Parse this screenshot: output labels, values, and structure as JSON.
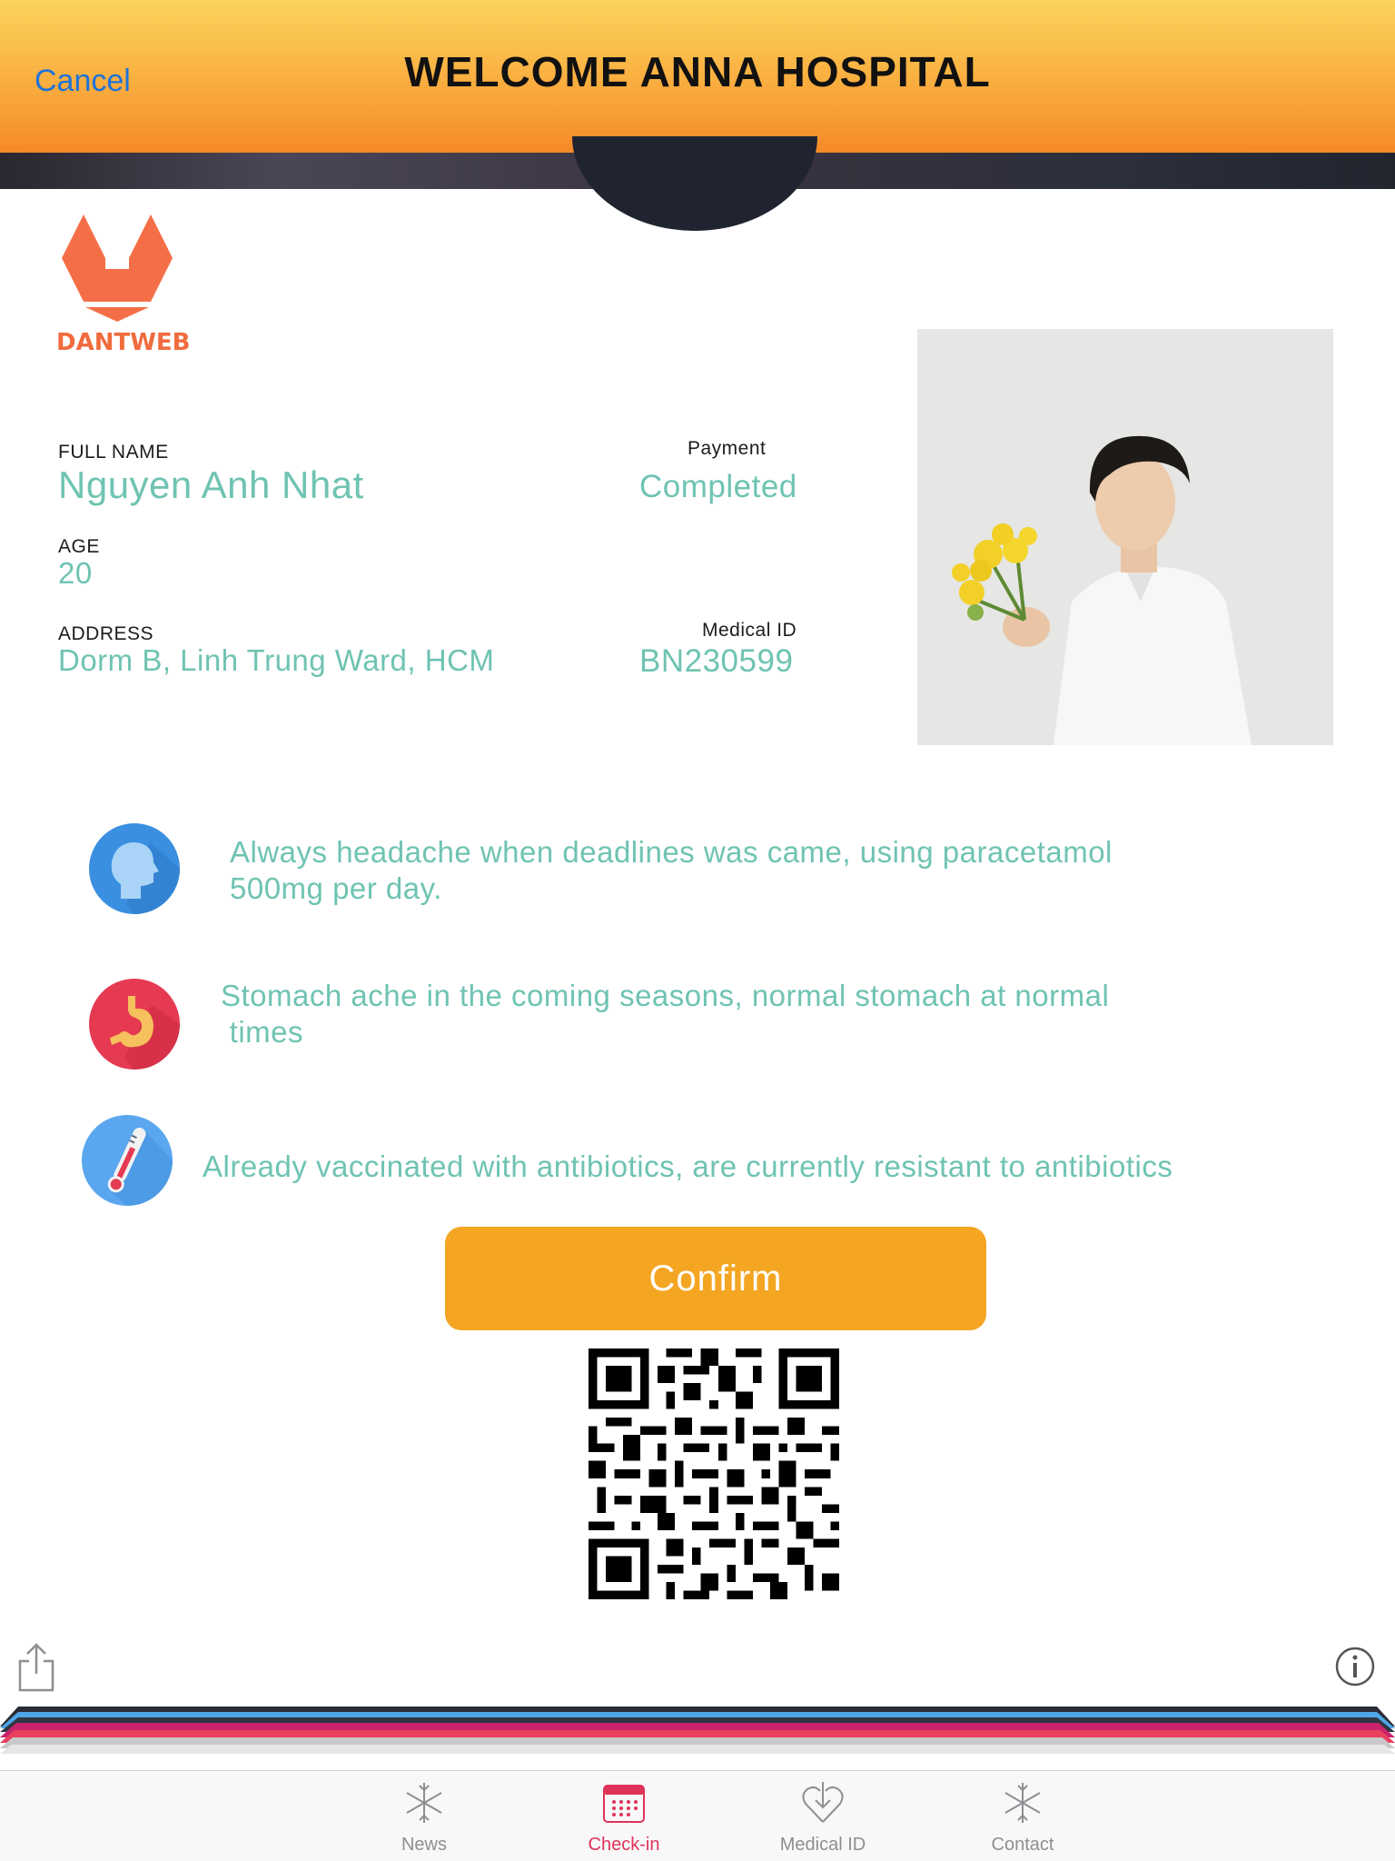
{
  "nav": {
    "cancel_label": "Cancel",
    "title": "WELCOME ANNA HOSPITAL"
  },
  "logo": {
    "text": "DANTWEB",
    "color": "#f06b3d"
  },
  "patient": {
    "full_name_label": "FULL NAME",
    "full_name": "Nguyen Anh Nhat",
    "payment_label": "Payment",
    "payment": "Completed",
    "age_label": "AGE",
    "age": "20",
    "address_label": "ADDRESS",
    "address": "Dorm B, Linh Trung Ward, HCM",
    "medical_id_label": "Medical ID",
    "medical_id": "BN230599"
  },
  "conditions": [
    {
      "icon": "head-icon",
      "color": "#3b8fe0",
      "line1": "Always headache when deadlines was came, using paracetamol",
      "line2": "500mg per day."
    },
    {
      "icon": "stomach-icon",
      "color": "#e53a52",
      "line1": "Stomach ache in the coming seasons, normal stomach at normal",
      "line2": " times"
    },
    {
      "icon": "thermometer-icon",
      "color": "#5aa7ef",
      "line1": "Already vaccinated with antibiotics, are currently resistant to antibiotics"
    }
  ],
  "confirm_label": "Confirm",
  "colors": {
    "accent_text": "#6fc3b2",
    "confirm": "#f4a623",
    "tab_active": "#e0335a",
    "link": "#1e73d9"
  },
  "tabs": [
    {
      "label": "News",
      "icon": "snowflake-icon",
      "active": false
    },
    {
      "label": "Check-in",
      "icon": "calendar-icon",
      "active": true
    },
    {
      "label": "Medical ID",
      "icon": "heart-download-icon",
      "active": false
    },
    {
      "label": "Contact",
      "icon": "snowflake-icon",
      "active": false
    }
  ]
}
